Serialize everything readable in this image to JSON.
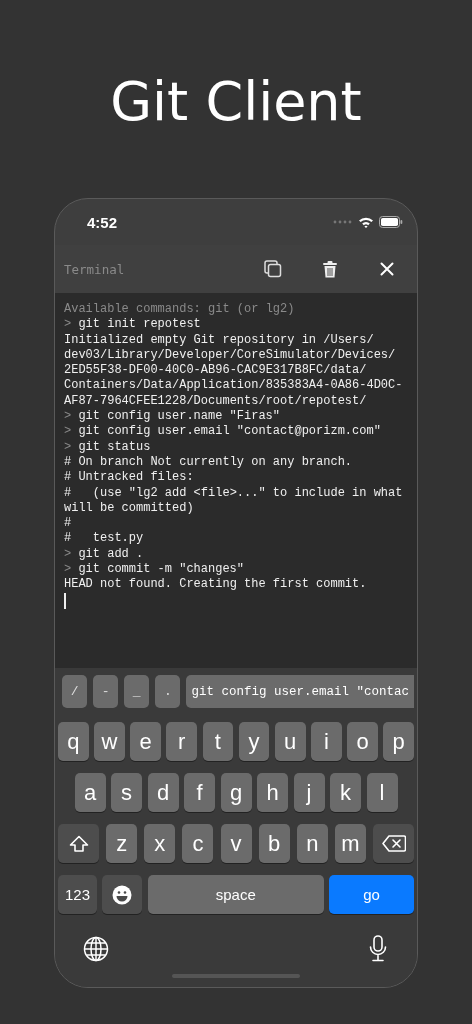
{
  "title": "Git Client",
  "status_bar": {
    "time": "4:52"
  },
  "toolbar": {
    "title": "Terminal"
  },
  "terminal": {
    "lines": [
      {
        "kind": "info",
        "text": "Available commands: git (or lg2)"
      },
      {
        "kind": "command",
        "prompt": ">",
        "text": "git init repotest"
      },
      {
        "kind": "output",
        "text": "Initialized empty Git repository in /Users/"
      },
      {
        "kind": "output",
        "text": "dev03/Library/Developer/CoreSimulator/Devices/"
      },
      {
        "kind": "output",
        "text": "2ED55F38-DF00-40C0-AB96-CAC9E317B8FC/data/"
      },
      {
        "kind": "output",
        "text": "Containers/Data/Application/835383A4-0A86-4D0C-"
      },
      {
        "kind": "output",
        "text": "AF87-7964CFEE1228/Documents/root/repotest/"
      },
      {
        "kind": "command",
        "prompt": ">",
        "text": "git config user.name \"Firas\""
      },
      {
        "kind": "command",
        "prompt": ">",
        "text": "git config user.email \"contact@porizm.com\""
      },
      {
        "kind": "command",
        "prompt": ">",
        "text": "git status"
      },
      {
        "kind": "output",
        "text": "# On branch Not currently on any branch."
      },
      {
        "kind": "output",
        "text": "# Untracked files:"
      },
      {
        "kind": "output",
        "text": "#   (use \"lg2 add <file>...\" to include in what"
      },
      {
        "kind": "output",
        "text": "will be committed)"
      },
      {
        "kind": "output",
        "text": "#"
      },
      {
        "kind": "output",
        "text": "#   test.py"
      },
      {
        "kind": "command",
        "prompt": ">",
        "text": "git add ."
      },
      {
        "kind": "command",
        "prompt": ">",
        "text": "git commit -m \"changes\""
      },
      {
        "kind": "output",
        "text": "HEAD not found. Creating the first commit."
      }
    ]
  },
  "accessory_bar": {
    "keys": [
      "/",
      "-",
      "_",
      "."
    ],
    "suggestion": "git config user.email \"contac"
  },
  "keyboard": {
    "rows": [
      [
        {
          "kind": "letter",
          "label": "q"
        },
        {
          "kind": "letter",
          "label": "w"
        },
        {
          "kind": "letter",
          "label": "e"
        },
        {
          "kind": "letter",
          "label": "r"
        },
        {
          "kind": "letter",
          "label": "t"
        },
        {
          "kind": "letter",
          "label": "y"
        },
        {
          "kind": "letter",
          "label": "u"
        },
        {
          "kind": "letter",
          "label": "i"
        },
        {
          "kind": "letter",
          "label": "o"
        },
        {
          "kind": "letter",
          "label": "p"
        }
      ],
      [
        {
          "kind": "letter",
          "label": "a"
        },
        {
          "kind": "letter",
          "label": "s"
        },
        {
          "kind": "letter",
          "label": "d"
        },
        {
          "kind": "letter",
          "label": "f"
        },
        {
          "kind": "letter",
          "label": "g"
        },
        {
          "kind": "letter",
          "label": "h"
        },
        {
          "kind": "letter",
          "label": "j"
        },
        {
          "kind": "letter",
          "label": "k"
        },
        {
          "kind": "letter",
          "label": "l"
        }
      ],
      [
        {
          "kind": "shift"
        },
        {
          "kind": "letter",
          "label": "z"
        },
        {
          "kind": "letter",
          "label": "x"
        },
        {
          "kind": "letter",
          "label": "c"
        },
        {
          "kind": "letter",
          "label": "v"
        },
        {
          "kind": "letter",
          "label": "b"
        },
        {
          "kind": "letter",
          "label": "n"
        },
        {
          "kind": "letter",
          "label": "m"
        },
        {
          "kind": "backspace"
        }
      ]
    ],
    "bottom_row": {
      "numbers_key": "123",
      "space_bar": "space",
      "return_key": "go"
    }
  }
}
